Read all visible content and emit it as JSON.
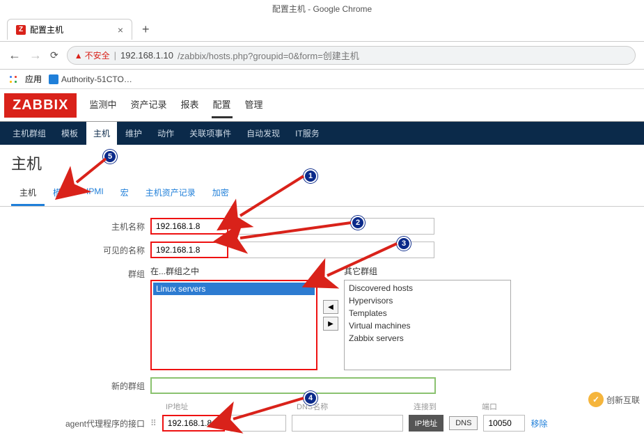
{
  "chrome": {
    "title": "配置主机 - Google Chrome",
    "tab_label": "配置主机",
    "insecure_label": "不安全",
    "url_host": "192.168.1.10",
    "url_path": "/zabbix/hosts.php?groupid=0&form=创建主机",
    "apps_label": "应用",
    "bookmark1": "Authority-51CTO…"
  },
  "zabbix": {
    "logo": "ZABBIX",
    "menu": [
      "监测中",
      "资产记录",
      "报表",
      "配置",
      "管理"
    ],
    "menu_active": "配置",
    "submenu": [
      "主机群组",
      "模板",
      "主机",
      "维护",
      "动作",
      "关联项事件",
      "自动发现",
      "IT服务"
    ],
    "submenu_active": "主机",
    "page_title": "主机",
    "form_tabs": [
      "主机",
      "模板",
      "IPMI",
      "宏",
      "主机资产记录",
      "加密"
    ],
    "form_tab_active": "主机"
  },
  "form": {
    "hostname_label": "主机名称",
    "hostname_value": "192.168.1.8",
    "visiblename_label": "可见的名称",
    "visiblename_value": "192.168.1.8",
    "groups_label": "群组",
    "in_group_head": "在...群组之中",
    "other_group_head": "其它群组",
    "in_groups": [
      "Linux servers"
    ],
    "other_groups": [
      "Discovered hosts",
      "Hypervisors",
      "Templates",
      "Virtual machines",
      "Zabbix servers"
    ],
    "newgroup_label": "新的群组",
    "newgroup_value": "",
    "iface_label": "agent代理程序的接口",
    "iface_heads": {
      "ip": "IP地址",
      "dns": "DNS名称",
      "conn": "连接到",
      "port": "端口"
    },
    "iface_ip": "192.168.1.8",
    "iface_dns": "",
    "iface_conn_ip": "IP地址",
    "iface_conn_dns": "DNS",
    "iface_port": "10050",
    "iface_remove": "移除"
  },
  "badges": {
    "b1": "1",
    "b2": "2",
    "b3": "3",
    "b4": "4",
    "b5": "5"
  },
  "brand": {
    "text": "创新互联",
    "icon": "✓"
  }
}
